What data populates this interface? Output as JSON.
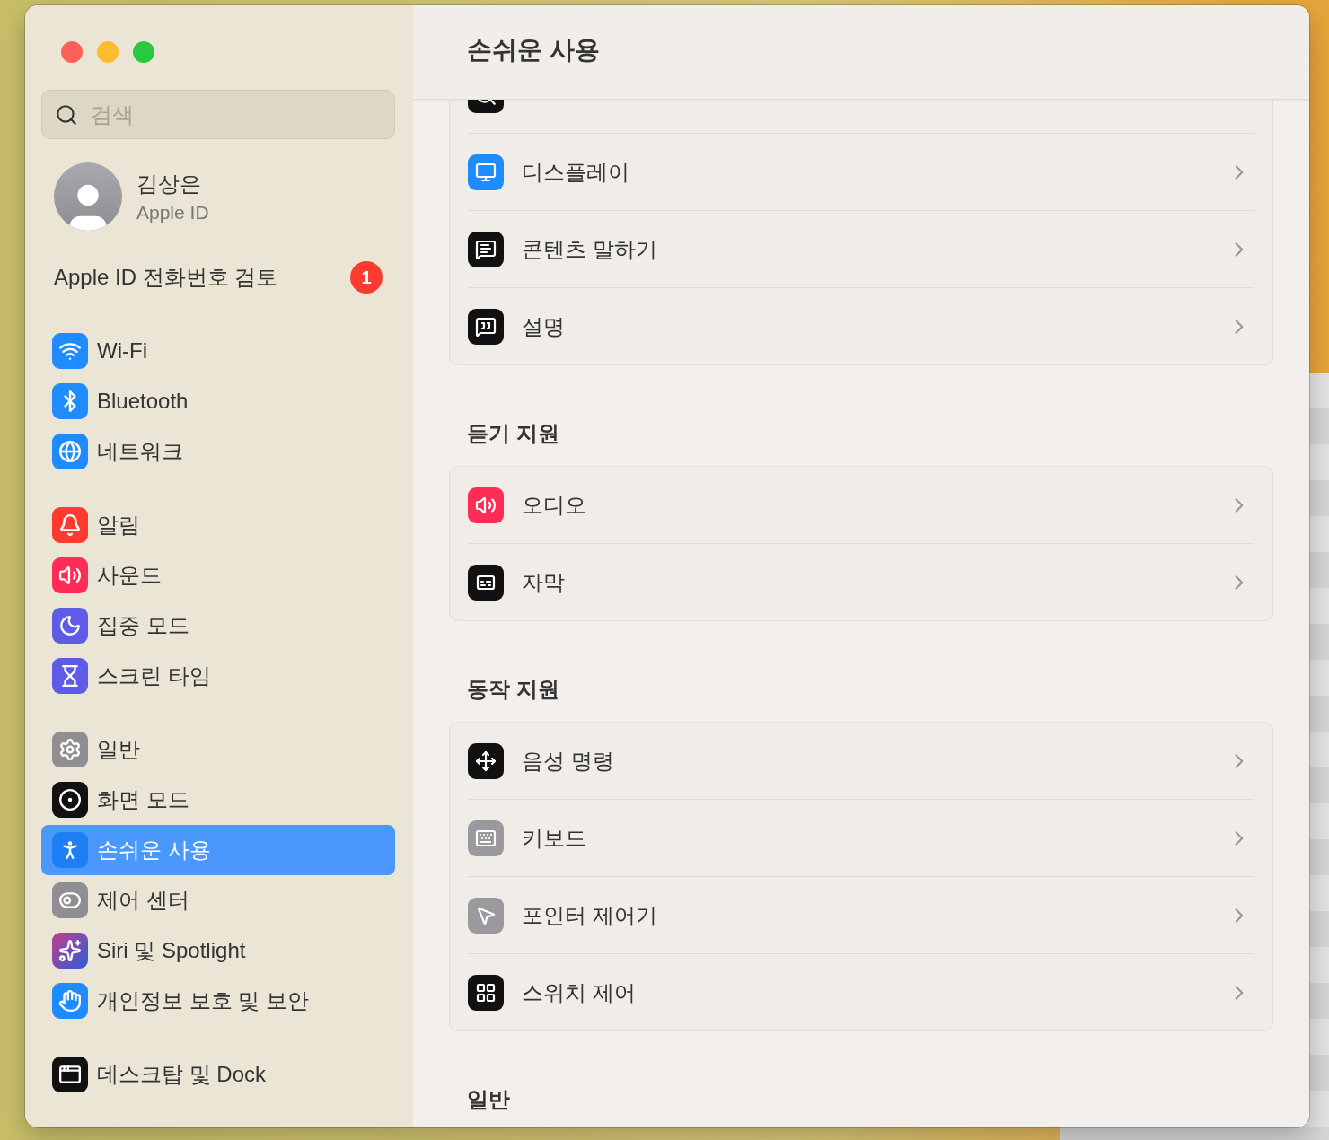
{
  "sidebar": {
    "search": {
      "placeholder": "검색"
    },
    "account": {
      "name": "김상은",
      "subtitle": "Apple ID"
    },
    "notice": {
      "label": "Apple ID 전화번호 검토",
      "badge": "1"
    },
    "groups": [
      {
        "items": [
          {
            "label": "Wi-Fi",
            "selected": false
          },
          {
            "label": "Bluetooth",
            "selected": false
          },
          {
            "label": "네트워크",
            "selected": false
          }
        ]
      },
      {
        "items": [
          {
            "label": "알림",
            "selected": false
          },
          {
            "label": "사운드",
            "selected": false
          },
          {
            "label": "집중 모드",
            "selected": false
          },
          {
            "label": "스크린 타임",
            "selected": false
          }
        ]
      },
      {
        "items": [
          {
            "label": "일반",
            "selected": false
          },
          {
            "label": "화면 모드",
            "selected": false
          },
          {
            "label": "손쉬운 사용",
            "selected": true
          },
          {
            "label": "제어 센터",
            "selected": false
          },
          {
            "label": "Siri 및 Spotlight",
            "selected": false
          },
          {
            "label": "개인정보 보호 및 보안",
            "selected": false
          }
        ]
      },
      {
        "items": [
          {
            "label": "데스크탑 및 Dock",
            "selected": false
          }
        ]
      }
    ]
  },
  "main": {
    "title": "손쉬운 사용",
    "sections": [
      {
        "rows": [
          {
            "label": "디스플레이"
          },
          {
            "label": "콘텐츠 말하기"
          },
          {
            "label": "설명"
          }
        ]
      },
      {
        "heading": "듣기 지원",
        "rows": [
          {
            "label": "오디오"
          },
          {
            "label": "자막"
          }
        ]
      },
      {
        "heading": "동작 지원",
        "rows": [
          {
            "label": "음성 명령"
          },
          {
            "label": "키보드"
          },
          {
            "label": "포인터 제어기"
          },
          {
            "label": "스위치 제어"
          }
        ]
      },
      {
        "heading": "일반"
      }
    ]
  }
}
